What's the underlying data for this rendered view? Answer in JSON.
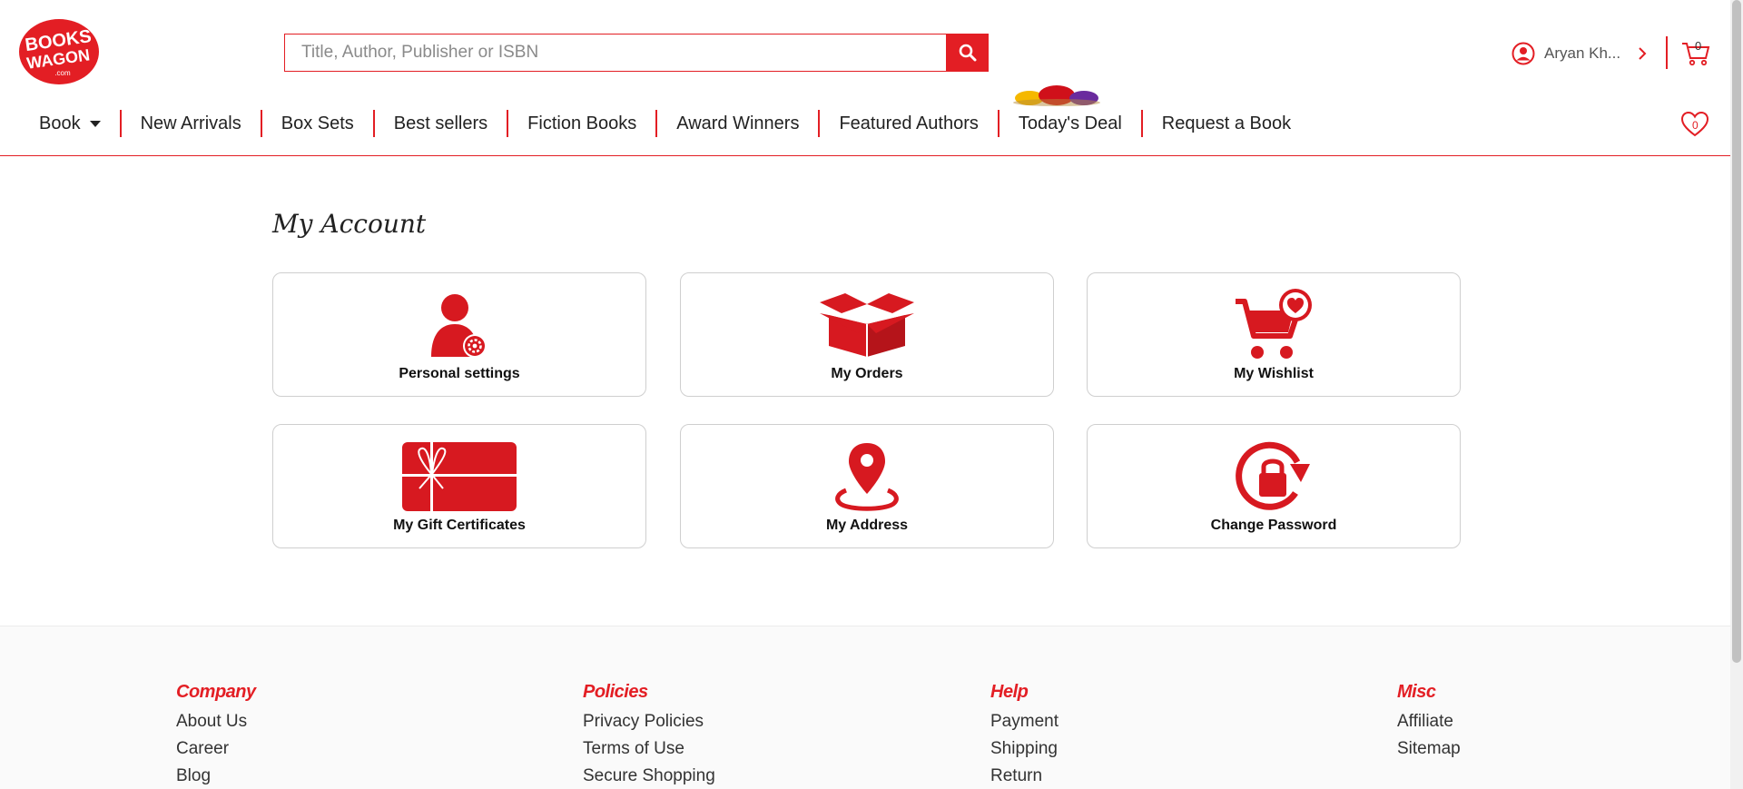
{
  "brand": {
    "logo_line1": "BOOKS",
    "logo_line2": "WAGON",
    "logo_line3": ".com",
    "accent_color": "#e31e24"
  },
  "search": {
    "placeholder": "Title, Author, Publisher or ISBN",
    "button_icon": "search-icon"
  },
  "account": {
    "user_name": "Aryan Kh...",
    "icon": "user-circle-icon"
  },
  "cart": {
    "count": "0",
    "icon": "cart-icon"
  },
  "wishlist": {
    "count": "0",
    "icon": "heart-icon"
  },
  "nav": {
    "items": [
      {
        "label": "Book"
      },
      {
        "label": "New Arrivals"
      },
      {
        "label": "Box Sets"
      },
      {
        "label": "Best sellers"
      },
      {
        "label": "Fiction Books"
      },
      {
        "label": "Award Winners"
      },
      {
        "label": "Featured Authors"
      },
      {
        "label": "Today's Deal"
      },
      {
        "label": "Request a Book"
      }
    ]
  },
  "main": {
    "title": "My Account",
    "cards": [
      {
        "label": "Personal settings",
        "icon": "user-settings-icon"
      },
      {
        "label": "My Orders",
        "icon": "open-box-icon"
      },
      {
        "label": "My Wishlist",
        "icon": "cart-heart-icon"
      },
      {
        "label": "My Gift Certificates",
        "icon": "gift-card-icon"
      },
      {
        "label": "My Address",
        "icon": "location-pin-icon"
      },
      {
        "label": "Change Password",
        "icon": "lock-refresh-icon"
      }
    ]
  },
  "footer": {
    "columns": [
      {
        "heading": "Company",
        "links": [
          "About Us",
          "Career",
          "Blog"
        ]
      },
      {
        "heading": "Policies",
        "links": [
          "Privacy Policies",
          "Terms of Use",
          "Secure Shopping"
        ]
      },
      {
        "heading": "Help",
        "links": [
          "Payment",
          "Shipping",
          "Return"
        ]
      },
      {
        "heading": "Misc",
        "links": [
          "Affiliate",
          "Sitemap"
        ]
      }
    ]
  }
}
